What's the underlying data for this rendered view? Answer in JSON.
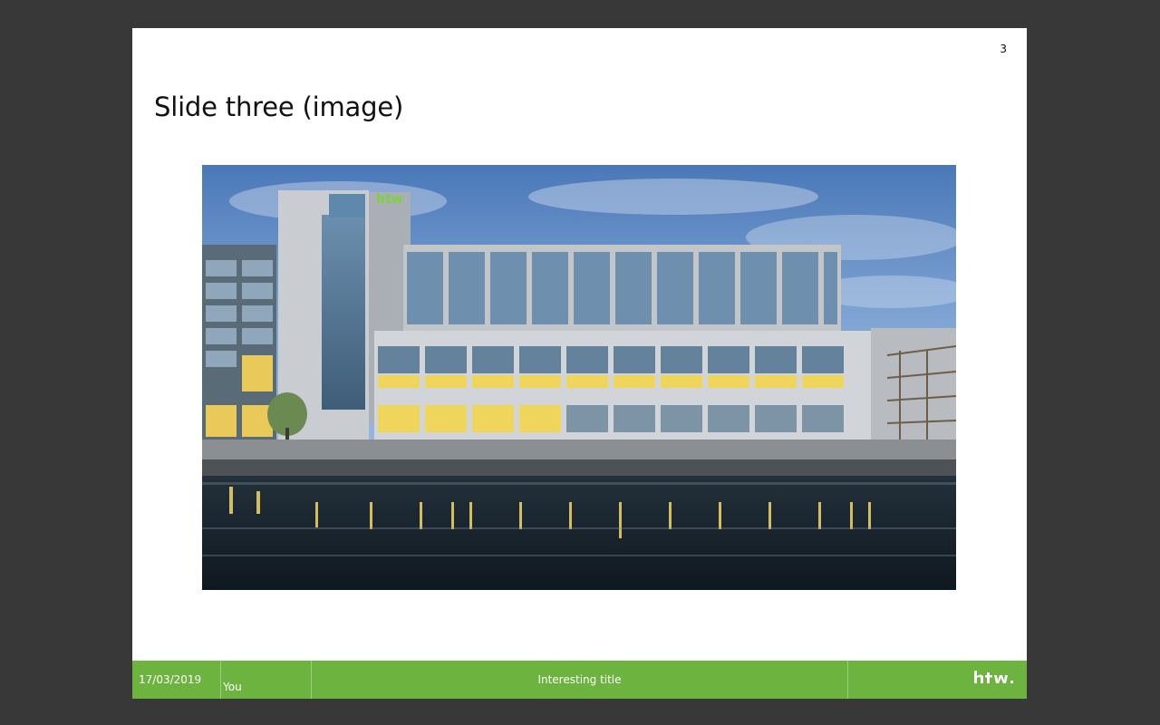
{
  "slide": {
    "number": "3",
    "title": "Slide three (image)"
  },
  "image": {
    "description_icon": "building-photo"
  },
  "footer": {
    "date": "17/03/2019",
    "author": "You",
    "title": "Interesting title",
    "logo_text": "htw."
  },
  "colors": {
    "background": "#383838",
    "slide": "#ffffff",
    "footer": "#6db33f"
  }
}
